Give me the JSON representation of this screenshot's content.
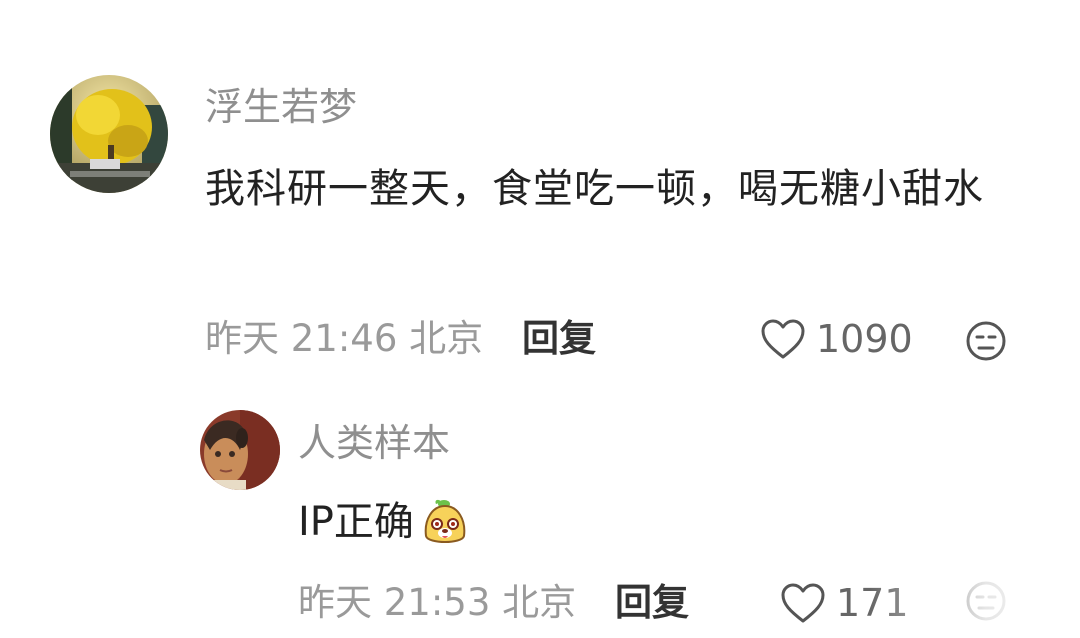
{
  "comments": [
    {
      "author": "浮生若梦",
      "text": "我科研一整天，食堂吃一顿，喝无糖小甜水",
      "meta": "昨天 21:46 北京",
      "reply_label": "回复",
      "likes": "1090",
      "icons": {
        "avatar": "avatar-ginkgo-photo",
        "like": "heart-outline-icon",
        "reaction": "neutral-face-icon"
      }
    },
    {
      "author": "人类样本",
      "text": "IP正确",
      "emoji": "dog-face-emoji",
      "meta": "昨天 21:53 北京",
      "reply_label": "回复",
      "likes": "171",
      "icons": {
        "avatar": "avatar-painting-portrait",
        "like": "heart-outline-icon",
        "reaction": "neutral-face-icon"
      }
    }
  ],
  "colors": {
    "name": "#8f8f8f",
    "text": "#222222",
    "meta": "#9a9a9a",
    "reply": "#333333"
  }
}
